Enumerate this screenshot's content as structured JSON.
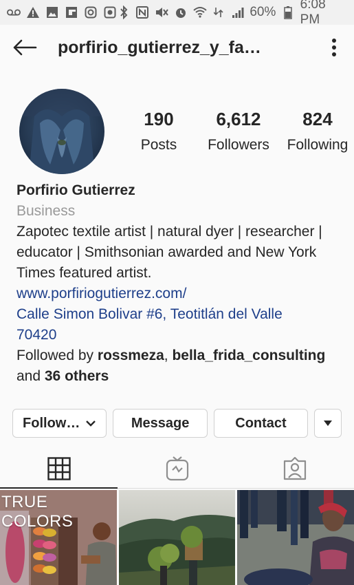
{
  "status_bar": {
    "battery": "60%",
    "time": "6:08 PM"
  },
  "nav": {
    "title": "porfirio_gutierrez_y_fa…"
  },
  "stats": [
    {
      "number": "190",
      "label": "Posts"
    },
    {
      "number": "6,612",
      "label": "Followers"
    },
    {
      "number": "824",
      "label": "Following"
    }
  ],
  "bio": {
    "name": "Porfirio Gutierrez",
    "category": "Business",
    "description_lines": [
      "Zapotec textile artist | natural dyer | researcher |",
      "educator | Smithsonian awarded and New York",
      "Times featured artist."
    ],
    "website": "www.porfiriogutierrez.com/",
    "address_lines": [
      "Calle Simon Bolivar #6, Teotitlán del Valle",
      "70420"
    ],
    "followed_by_prefix": "Followed by ",
    "followed_by_user1": "rossmeza",
    "followed_by_sep": ", ",
    "followed_by_user2": "bella_frida_consulting",
    "followed_by_and": "and ",
    "followed_by_others": "36 others"
  },
  "actions": {
    "follow": "Follow…",
    "message": "Message",
    "contact": "Contact"
  },
  "grid": {
    "post1_text": "TRUE COLORS"
  },
  "colors": {
    "link": "#1e3f8a",
    "background": "#fafafa"
  }
}
